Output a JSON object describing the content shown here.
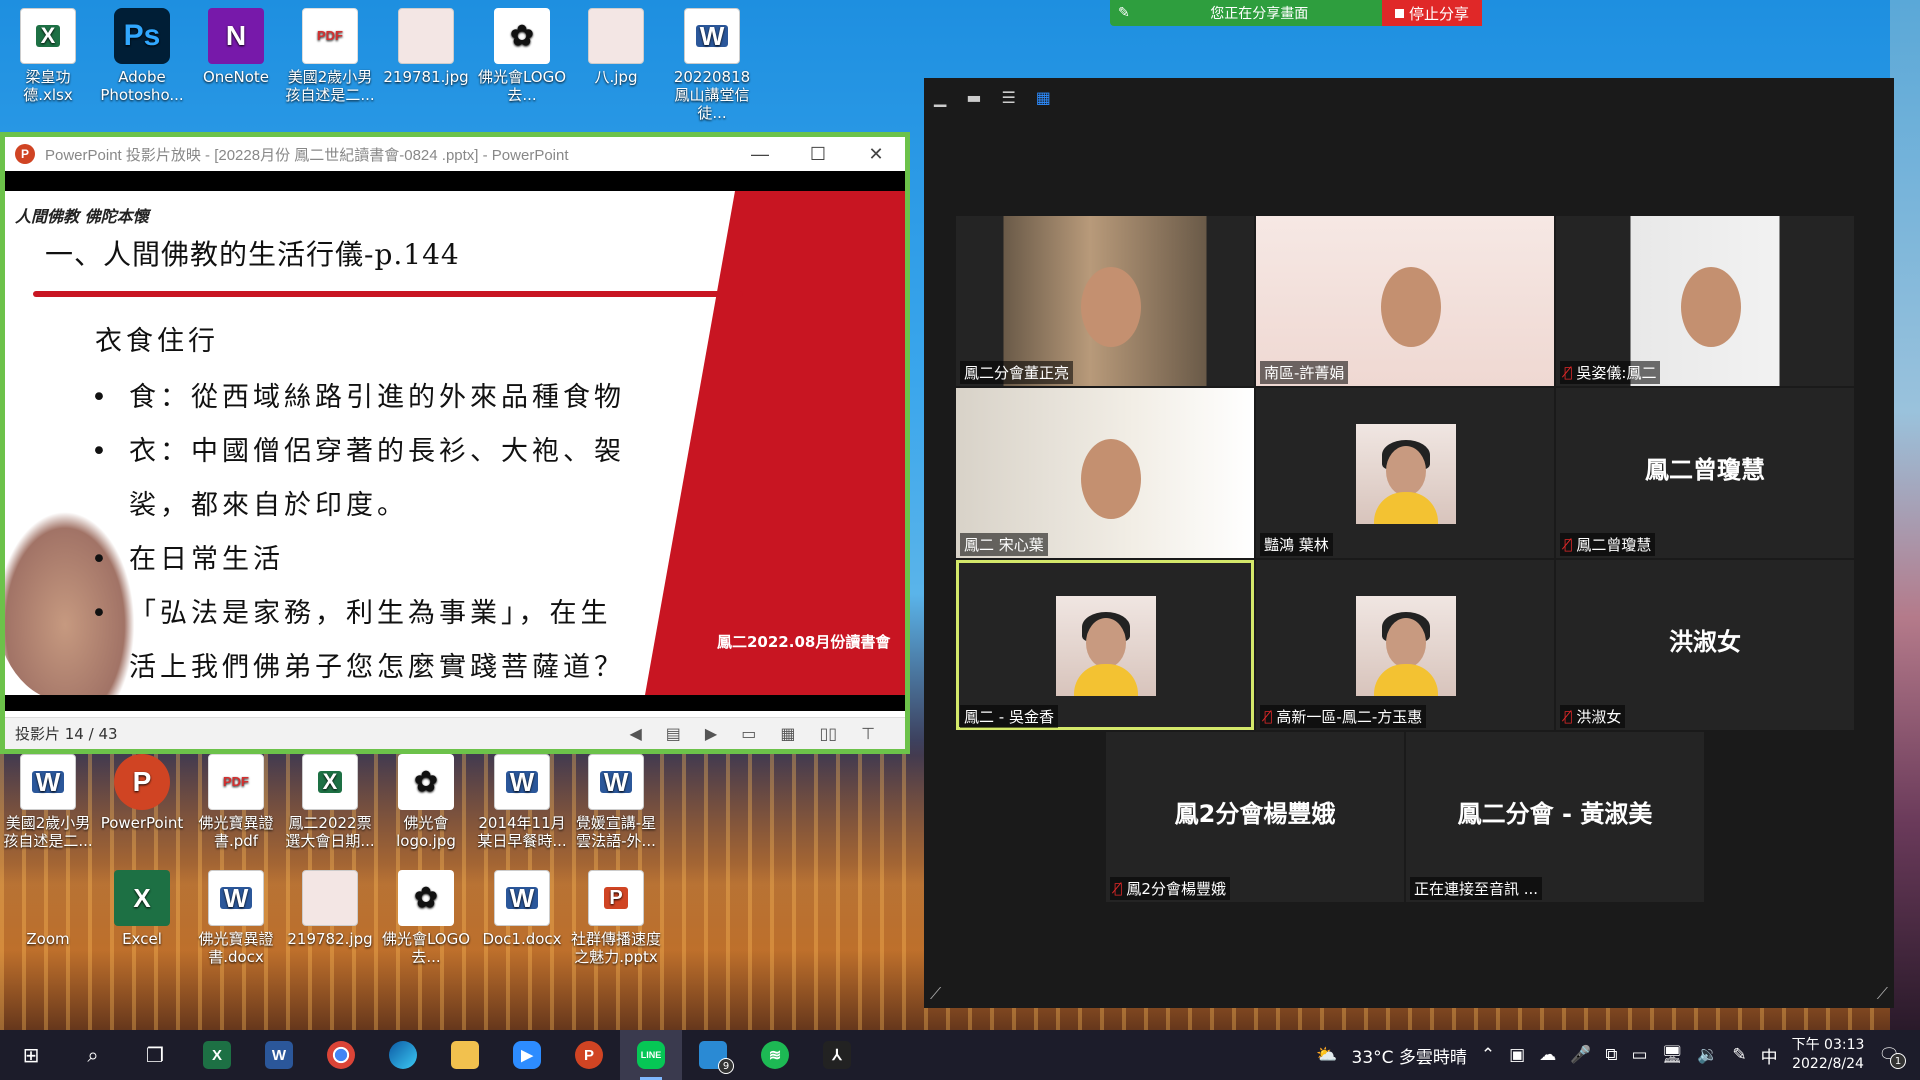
{
  "desktop_icons_top": [
    {
      "label": "梁皇功德.xlsx",
      "icon": "excel-file-icon"
    },
    {
      "label": "Adobe Photosho...",
      "icon": "photoshop-icon"
    },
    {
      "label": "OneNote",
      "icon": "onenote-icon"
    },
    {
      "label": "美國2歲小男孩自述是二...",
      "icon": "pdf-file-icon"
    },
    {
      "label": "219781.jpg",
      "icon": "image-file-icon"
    },
    {
      "label": "佛光會LOGO 去...",
      "icon": "logo-image-icon"
    },
    {
      "label": "八.jpg",
      "icon": "image-file-icon"
    },
    {
      "label": "20220818 鳳山講堂信徒...",
      "icon": "word-file-icon"
    }
  ],
  "desktop_icons_mid": [
    {
      "label": "美國2歲小男孩自述是二...",
      "icon": "word-file-icon"
    },
    {
      "label": "PowerPoint",
      "icon": "powerpoint-icon"
    },
    {
      "label": "佛光寶異證書.pdf",
      "icon": "pdf-file-icon"
    },
    {
      "label": "鳳二2022票選大會日期...",
      "icon": "excel-file-icon"
    },
    {
      "label": "佛光會logo.jpg",
      "icon": "logo-image-icon"
    },
    {
      "label": "2014年11月某日早餐時...",
      "icon": "word-file-icon"
    },
    {
      "label": "覺媛宣講-星雲法語-外...",
      "icon": "word-file-icon"
    }
  ],
  "desktop_icons_bottom": [
    {
      "label": "Zoom",
      "icon": "zoom-icon"
    },
    {
      "label": "Excel",
      "icon": "excel-icon"
    },
    {
      "label": "佛光寶異證書.docx",
      "icon": "word-file-icon"
    },
    {
      "label": "219782.jpg",
      "icon": "image-file-icon"
    },
    {
      "label": "佛光會LOGO 去...",
      "icon": "logo-image-icon"
    },
    {
      "label": "Doc1.docx",
      "icon": "word-file-icon"
    },
    {
      "label": "社群傳播速度之魅力.pptx",
      "icon": "ppt-file-icon"
    }
  ],
  "share_bar": {
    "status": "您正在分享畫面",
    "stop_label": "停止分享"
  },
  "powerpoint": {
    "title": "PowerPoint 投影片放映 - [20228月份 鳳二世紀讀書會-0824 .pptx] - PowerPoint",
    "slide_counter": "投影片 14 / 43",
    "slide": {
      "brand": "人間佛教 佛陀本懷",
      "title": "一、人間佛教的生活行儀-p.144",
      "subtitle": "衣食住行",
      "bullets": [
        [
          "食：從西域絲路引進的外來品種食物"
        ],
        [
          "衣：中國僧侶穿著的長衫、大袍、袈",
          "裟，都來自於印度。"
        ],
        [
          "在日常生活"
        ],
        [
          "「弘法是家務，利生為事業」，在生",
          "活上我們佛弟子您怎麼實踐菩薩道？"
        ]
      ],
      "footer": "鳳二2022.08月份讀書會"
    }
  },
  "zoom": {
    "participants": [
      {
        "name": "鳳二分會董正亮",
        "muted": false,
        "type": "video"
      },
      {
        "name": "南區-許菁娟",
        "muted": false,
        "type": "video"
      },
      {
        "name": "吳姿儀:鳳二",
        "muted": true,
        "type": "video"
      },
      {
        "name": "鳳二 宋心葉",
        "muted": false,
        "type": "video"
      },
      {
        "name": "豔鴻 葉林",
        "muted": false,
        "type": "avatar"
      },
      {
        "name": "鳳二曾瓊慧",
        "muted": true,
        "type": "name",
        "big": "鳳二曾瓊慧"
      },
      {
        "name": "鳳二 - 吳金香",
        "muted": false,
        "type": "avatar"
      },
      {
        "name": "高新一區-鳳二-方玉惠",
        "muted": true,
        "type": "avatar"
      },
      {
        "name": "洪淑女",
        "muted": true,
        "type": "name",
        "big": "洪淑女"
      },
      {
        "name": "鳳2分會楊豐娥",
        "muted": true,
        "type": "name",
        "big": "鳳2分會楊豐娥"
      },
      {
        "name": "正在連接至音訊 ...",
        "muted": false,
        "type": "name",
        "big": "鳳二分會 - 黃淑美"
      }
    ]
  },
  "taskbar": {
    "weather": "33°C 多雲時晴",
    "ime": "中",
    "time": "下午 03:13",
    "date": "2022/8/24",
    "notification_count": "1",
    "store_badge": "9"
  }
}
